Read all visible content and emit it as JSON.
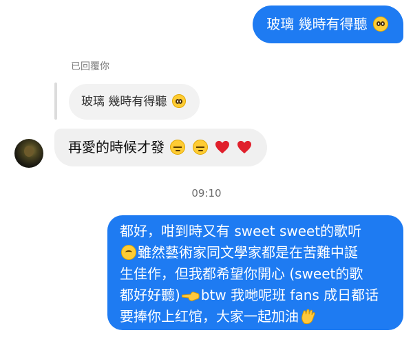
{
  "outgoing_message_1": {
    "text": "玻璃 幾時有得聽",
    "emoji": "pleading-face-icon"
  },
  "reply": {
    "label": "已回覆你",
    "quoted_text": "玻璃 幾時有得聽",
    "quoted_emoji": "pleading-face-icon"
  },
  "incoming_message_1": {
    "text": "再愛的時候才發",
    "emojis": [
      "pensive-face-icon",
      "pensive-face-icon",
      "red-heart-icon",
      "red-heart-icon"
    ]
  },
  "timestamp": "09:10",
  "outgoing_message_2": {
    "line_1": "都好，咁到時又有 sweet sweet的歌听",
    "line_2": "雖然藝術家同文學家都是在苦難中誕",
    "line_3": "生佳作，但我都希望你開心 (sweet的歌",
    "line_4a": "都好好聽)",
    "line_4b": "btw 我哋呢班 fans 成日都话",
    "line_5": "要捧你上红馆，大家一起加油",
    "emojis": [
      "thinking-face-icon",
      "pointing-hand-icon",
      "clapping-hands-icon"
    ]
  },
  "colors": {
    "outgoing_bubble": "#1e7bf2",
    "incoming_bubble": "#f0f0f0",
    "background": "#ffffff"
  }
}
